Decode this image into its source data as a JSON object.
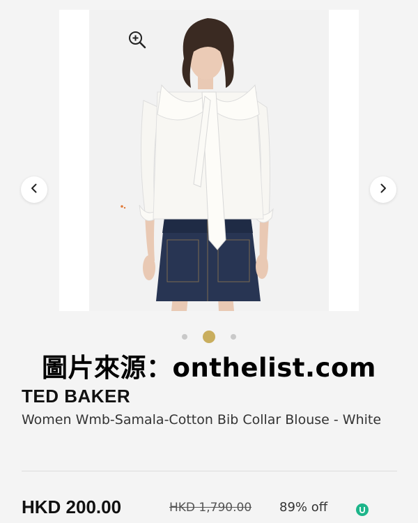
{
  "product": {
    "brand": "TED BAKER",
    "name": "Women Wmb-Samala-Cotton Bib Collar Blouse - White",
    "price_current": "HKD 200.00",
    "price_original": "HKD 1,790.00",
    "discount": "89% off"
  },
  "gallery": {
    "image_count": 3,
    "active_index": 1,
    "zoom_icon": "zoom-in-icon",
    "prev_icon": "chevron-left-icon",
    "next_icon": "chevron-right-icon",
    "active_dot_color": "#c9ae5e",
    "inactive_dot_color": "#c9c9c9"
  },
  "watermark": {
    "text": "圖片來源：onthelist.com"
  },
  "logo": {
    "text": "U"
  }
}
